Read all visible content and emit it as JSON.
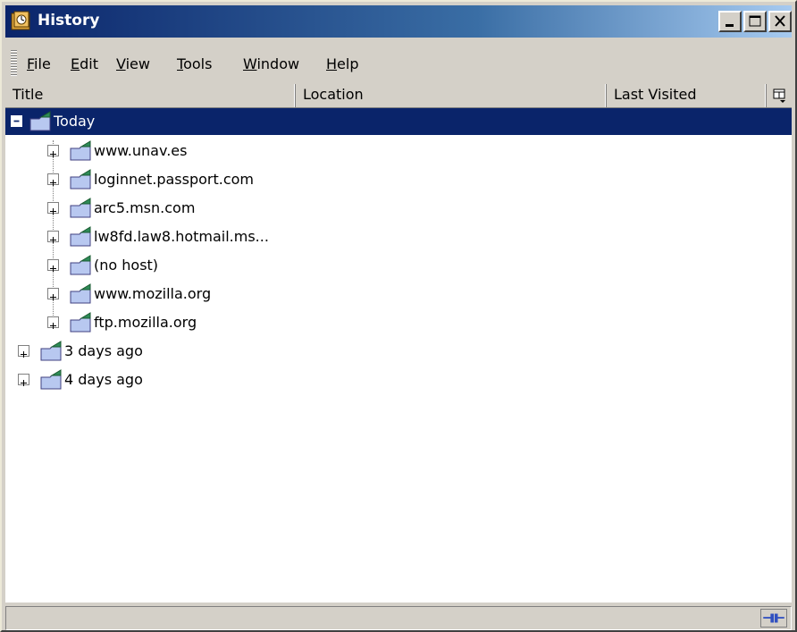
{
  "window": {
    "title": "History"
  },
  "menu": [
    "File",
    "Edit",
    "View",
    "Tools",
    "Window",
    "Help"
  ],
  "menu_access_keys": [
    "F",
    "E",
    "V",
    "T",
    "W",
    "H"
  ],
  "columns": [
    "Title",
    "Location",
    "Last Visited"
  ],
  "tree": {
    "today_label": "Today",
    "today_children": [
      "www.unav.es",
      "loginnet.passport.com",
      "arc5.msn.com",
      "lw8fd.law8.hotmail.ms...",
      "(no host)",
      "www.mozilla.org",
      "ftp.mozilla.org"
    ],
    "older_groups": [
      "3 days ago",
      "4 days ago"
    ]
  },
  "colors": {
    "title_bar": "#0a246a",
    "selection": "#0a246a",
    "chrome": "#d4d0c8"
  },
  "icons": {
    "window": "history-app-icon",
    "folder": "folder-icon",
    "expander": "plus-box-icon",
    "online": "online-plug-icon",
    "column_picker": "column-picker-icon"
  }
}
